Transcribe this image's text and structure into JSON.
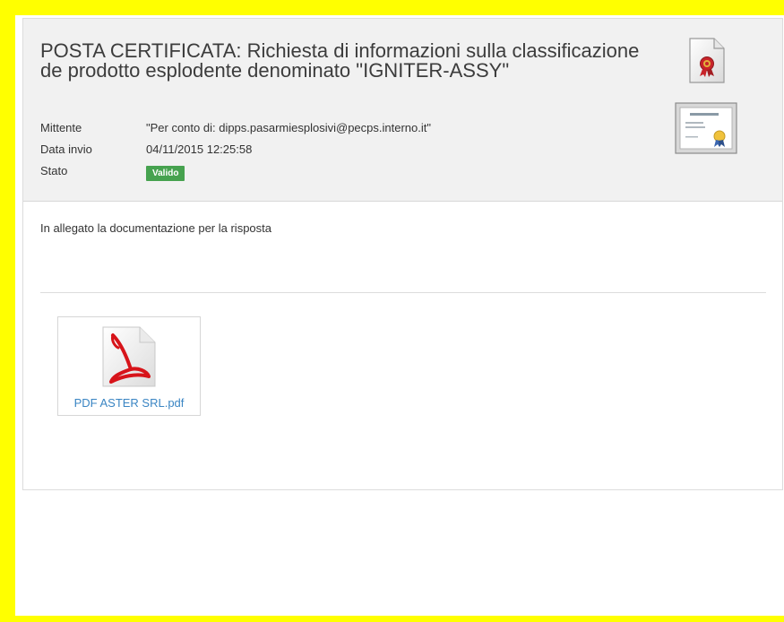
{
  "message": {
    "subject": "POSTA CERTIFICATA: Richiesta di informazioni sulla classificazione de prodotto esplodente denominato \"IGNITER-ASSY\"",
    "fields": {
      "sender_label": "Mittente",
      "sender_value": "\"Per conto di: dipps.pasarmiesplosivi@pecps.interno.it\"",
      "date_label": "Data invio",
      "date_value": "04/11/2015 12:25:58",
      "status_label": "Stato",
      "status_value": "Valido"
    },
    "icons": {
      "header_document": "certified-document-icon",
      "header_certificate": "certificate-icon",
      "attachment": "pdf-file-icon"
    },
    "body": "In allegato la documentazione per la risposta",
    "attachments": [
      {
        "name": "PDF ASTER SRL.pdf"
      }
    ]
  },
  "colors": {
    "frame": "#ffff00",
    "status_badge": "#46a24f",
    "link": "#3a85c3",
    "header_bg": "#f1f1f1"
  }
}
